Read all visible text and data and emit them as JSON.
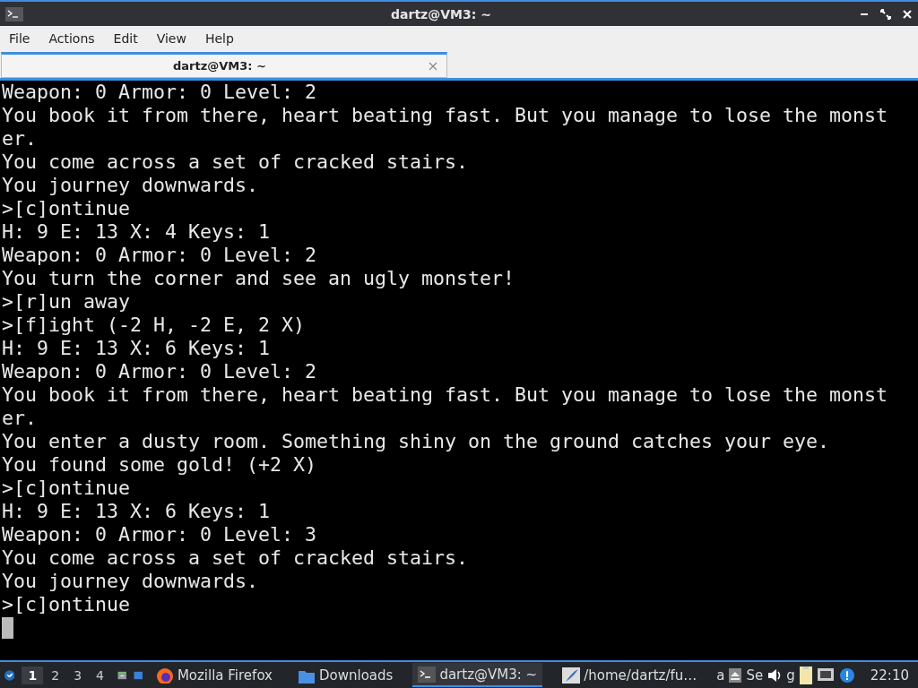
{
  "window": {
    "title": "dartz@VM3: ~"
  },
  "menu": [
    "File",
    "Actions",
    "Edit",
    "View",
    "Help"
  ],
  "tabs": [
    {
      "label": "dartz@VM3: ~",
      "selected": true
    }
  ],
  "terminal": {
    "lines": [
      "Weapon: 0 Armor: 0 Level: 2",
      "You book it from there, heart beating fast. But you manage to lose the monst",
      "er.",
      "You come across a set of cracked stairs.",
      "You journey downwards.",
      ">[c]ontinue",
      "H: 9 E: 13 X: 4 Keys: 1",
      "Weapon: 0 Armor: 0 Level: 2",
      "You turn the corner and see an ugly monster!",
      ">[r]un away",
      ">[f]ight (-2 H, -2 E, 2 X)",
      "H: 9 E: 13 X: 6 Keys: 1",
      "Weapon: 0 Armor: 0 Level: 2",
      "You book it from there, heart beating fast. But you manage to lose the monst",
      "er.",
      "You enter a dusty room. Something shiny on the ground catches your eye.",
      "You found some gold! (+2 X)",
      ">[c]ontinue",
      "H: 9 E: 13 X: 6 Keys: 1",
      "Weapon: 0 Armor: 0 Level: 3",
      "You come across a set of cracked stairs.",
      "You journey downwards.",
      ">[c]ontinue"
    ],
    "cursor": true
  },
  "taskbar": {
    "workspaces": [
      {
        "label": "1",
        "selected": true
      },
      {
        "label": "2",
        "selected": false
      },
      {
        "label": "3",
        "selected": false
      },
      {
        "label": "4",
        "selected": false
      }
    ],
    "tasks": [
      {
        "kind": "firefox",
        "label": "Mozilla Firefox",
        "selected": false
      },
      {
        "kind": "folder",
        "label": "Downloads",
        "selected": false
      },
      {
        "kind": "terminal",
        "label": "dartz@VM3: ~",
        "selected": true
      },
      {
        "kind": "editor",
        "label": "/home/dartz/fu…",
        "selected": false
      }
    ],
    "tray": [
      "a",
      "Se",
      "g"
    ],
    "clock": "22:10"
  }
}
